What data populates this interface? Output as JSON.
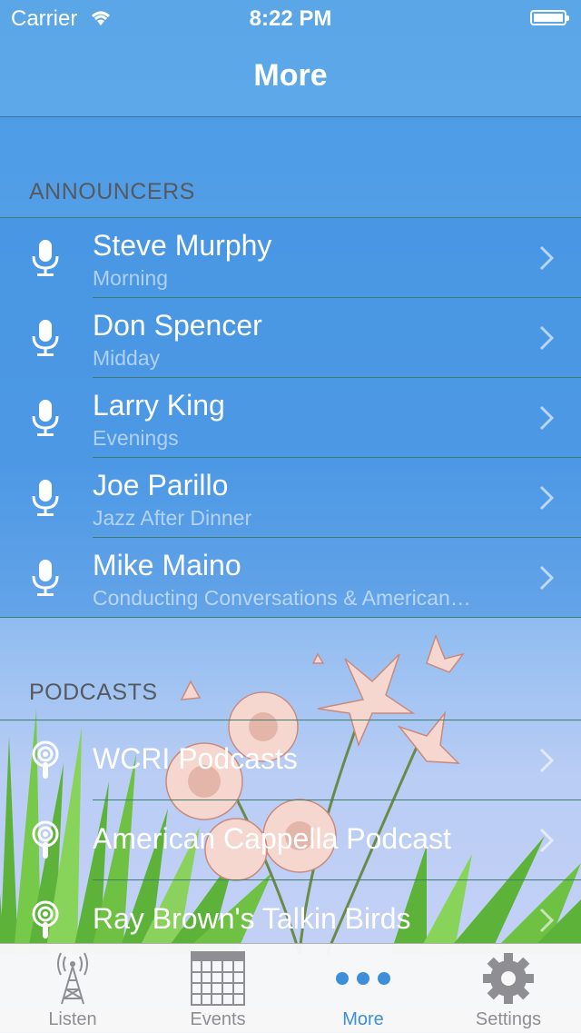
{
  "status_bar": {
    "carrier": "Carrier",
    "time": "8:22 PM"
  },
  "nav": {
    "title": "More"
  },
  "sections": {
    "announcers_header": "ANNOUNCERS",
    "podcasts_header": "PODCASTS"
  },
  "announcers": [
    {
      "name": "Steve Murphy",
      "slot": "Morning",
      "icon": "microphone-icon"
    },
    {
      "name": "Don Spencer",
      "slot": "Midday",
      "icon": "microphone-icon"
    },
    {
      "name": "Larry King",
      "slot": "Evenings",
      "icon": "microphone-icon"
    },
    {
      "name": "Joe Parillo",
      "slot": "Jazz After Dinner",
      "icon": "microphone-icon"
    },
    {
      "name": "Mike Maino",
      "slot": "Conducting Conversations & American…",
      "icon": "microphone-icon"
    }
  ],
  "podcasts": [
    {
      "name": "WCRI Podcasts",
      "icon": "podcast-icon"
    },
    {
      "name": "American Cappella Podcast",
      "icon": "podcast-icon"
    },
    {
      "name": "Ray Brown's Talkin Birds",
      "icon": "podcast-icon"
    }
  ],
  "tabs": [
    {
      "label": "Listen",
      "icon": "radio-tower-icon"
    },
    {
      "label": "Events",
      "icon": "calendar-icon"
    },
    {
      "label": "More",
      "icon": "more-dots-icon",
      "active": true
    },
    {
      "label": "Settings",
      "icon": "gear-icon"
    }
  ],
  "colors": {
    "accent": "#3d8fd9",
    "nav_bg": "#5aa6e6",
    "list_bg": "#4290e2",
    "separator": "#3e7d6b"
  }
}
